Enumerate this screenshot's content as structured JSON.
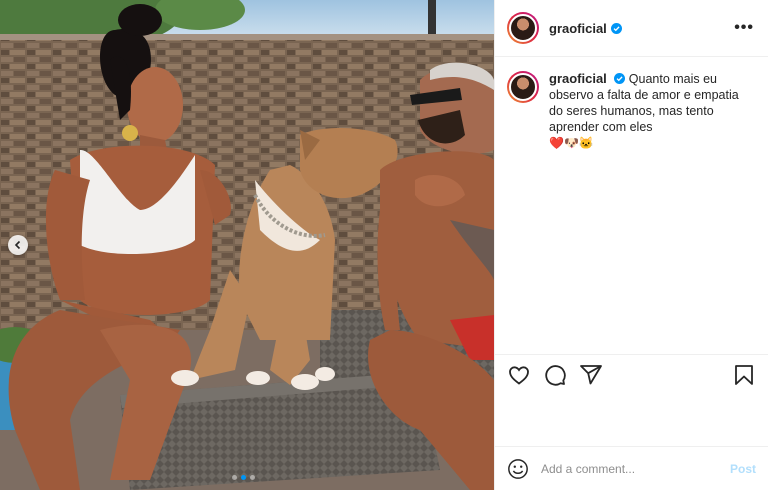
{
  "post": {
    "username": "graoficial",
    "verified": true,
    "caption": "Quanto mais eu observo a falta de amor e empatia do seres humanos, mas tento aprender com eles",
    "caption_emojis": "❤️🐶🐱",
    "photo_alt": "",
    "carousel": {
      "total": 3,
      "active": 2
    }
  },
  "comment": {
    "placeholder": "Add a comment...",
    "post_label": "Post"
  },
  "icons": [
    "more-icon",
    "verified-badge-icon",
    "previous-arrow-icon",
    "heart-icon",
    "comment-icon",
    "share-icon",
    "bookmark-icon",
    "emoji-icon"
  ],
  "colors": {
    "accent": "#0095f6",
    "post_disabled": "#b2dffc",
    "border": "#efefef"
  }
}
